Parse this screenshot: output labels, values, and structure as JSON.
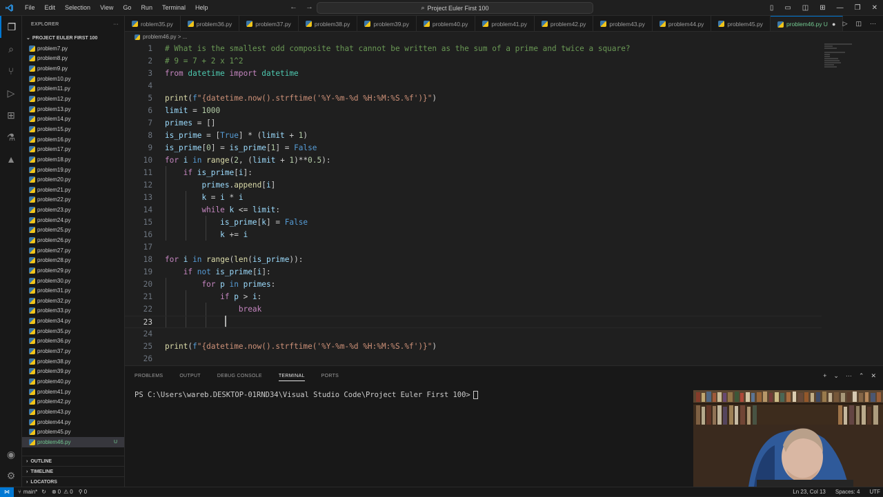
{
  "menu": [
    "File",
    "Edit",
    "Selection",
    "View",
    "Go",
    "Run",
    "Terminal",
    "Help"
  ],
  "search": {
    "text": "Project Euler First 100"
  },
  "explorer": {
    "title": "EXPLORER",
    "folder": "PROJECT EULER FIRST 100",
    "files": [
      "problem7.py",
      "problem8.py",
      "problem9.py",
      "problem10.py",
      "problem11.py",
      "problem12.py",
      "problem13.py",
      "problem14.py",
      "problem15.py",
      "problem16.py",
      "problem17.py",
      "problem18.py",
      "problem19.py",
      "problem20.py",
      "problem21.py",
      "problem22.py",
      "problem23.py",
      "problem24.py",
      "problem25.py",
      "problem26.py",
      "problem27.py",
      "problem28.py",
      "problem29.py",
      "problem30.py",
      "problem31.py",
      "problem32.py",
      "problem33.py",
      "problem34.py",
      "problem35.py",
      "problem36.py",
      "problem37.py",
      "problem38.py",
      "problem39.py",
      "problem40.py",
      "problem41.py",
      "problem42.py",
      "problem43.py",
      "problem44.py",
      "problem45.py",
      "problem46.py"
    ],
    "active_file": "problem46.py",
    "active_flag": "U",
    "outline": "OUTLINE",
    "timeline": "TIMELINE",
    "locators": "LOCATORS"
  },
  "tabs": [
    {
      "label": "roblem35.py",
      "active": false
    },
    {
      "label": "problem36.py",
      "active": false
    },
    {
      "label": "problem37.py",
      "active": false
    },
    {
      "label": "problem38.py",
      "active": false
    },
    {
      "label": "problem39.py",
      "active": false
    },
    {
      "label": "problem40.py",
      "active": false
    },
    {
      "label": "problem41.py",
      "active": false
    },
    {
      "label": "problem42.py",
      "active": false
    },
    {
      "label": "problem43.py",
      "active": false
    },
    {
      "label": "problem44.py",
      "active": false
    },
    {
      "label": "problem45.py",
      "active": false
    },
    {
      "label": "problem46.py U",
      "active": true
    }
  ],
  "breadcrumb": "problem46.py > ...",
  "code_lines": [
    "# What is the smallest odd composite that cannot be written as the sum of a prime and twice a square?",
    "# 9 = 7 + 2 x 1^2",
    "from datetime import datetime",
    "",
    "print(f\"{datetime.now().strftime('%Y-%m-%d %H:%M:%S.%f')}\")",
    "limit = 1000",
    "primes = []",
    "is_prime = [True] * (limit + 1)",
    "is_prime[0] = is_prime[1] = False",
    "for i in range(2, (limit + 1)**0.5):",
    "    if is_prime[i]:",
    "        primes.append[i]",
    "        k = i * i",
    "        while k <= limit:",
    "            is_prime[k] = False",
    "            k += i",
    "",
    "for i in range(len(is_prime)):",
    "    if not is_prime[i]:",
    "        for p in primes:",
    "            if p > i:",
    "                break",
    "",
    "",
    "print(f\"{datetime.now().strftime('%Y-%m-%d %H:%M:%S.%f')}\")",
    ""
  ],
  "current_line": 23,
  "panel": {
    "tabs": [
      "PROBLEMS",
      "OUTPUT",
      "DEBUG CONSOLE",
      "TERMINAL",
      "PORTS"
    ],
    "active_tab": "TERMINAL",
    "terminal_prompt": "PS C:\\Users\\wareb.DESKTOP-01RND34\\Visual Studio Code\\Project Euler First 100>"
  },
  "status": {
    "branch": "main*",
    "errors": "0",
    "warnings": "0",
    "ports": "0",
    "position": "Ln 23, Col 13",
    "spaces": "Spaces: 4",
    "encoding": "UTF"
  }
}
